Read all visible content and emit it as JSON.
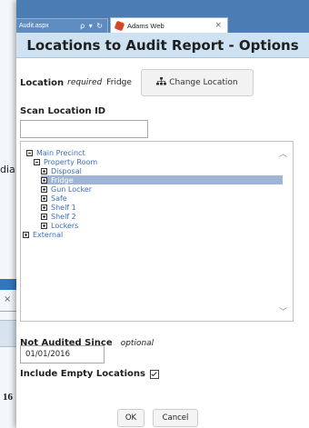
{
  "background": {
    "fragment_dia": "dia",
    "fragment_close": "×",
    "fragment_16": "16"
  },
  "browser": {
    "url_text": "Audit.aspx",
    "url_icons": "ρ ▾ ↻",
    "tab_title": "Adams Web",
    "tab_close": "×"
  },
  "dialog": {
    "title": "Locations to Audit Report - Options",
    "location_label": "Location",
    "location_required": "required",
    "location_value": "Fridge",
    "change_location_label": "Change Location",
    "scan_label": "Scan Location ID",
    "scan_value": "",
    "tree": {
      "main_precinct": "Main Precinct",
      "property_room": "Property Room",
      "disposal": "Disposal",
      "fridge": "Fridge",
      "gun_locker": "Gun Locker",
      "safe": "Safe",
      "shelf_1": "Shelf 1",
      "shelf_2": "Shelf 2",
      "lockers": "Lockers",
      "external": "External"
    },
    "not_audited_label": "Not Audited Since",
    "not_audited_optional": "optional",
    "not_audited_value": "01/01/2016",
    "include_empty_label": "Include Empty Locations",
    "include_empty_checked": true,
    "ok_label": "OK",
    "cancel_label": "Cancel"
  }
}
